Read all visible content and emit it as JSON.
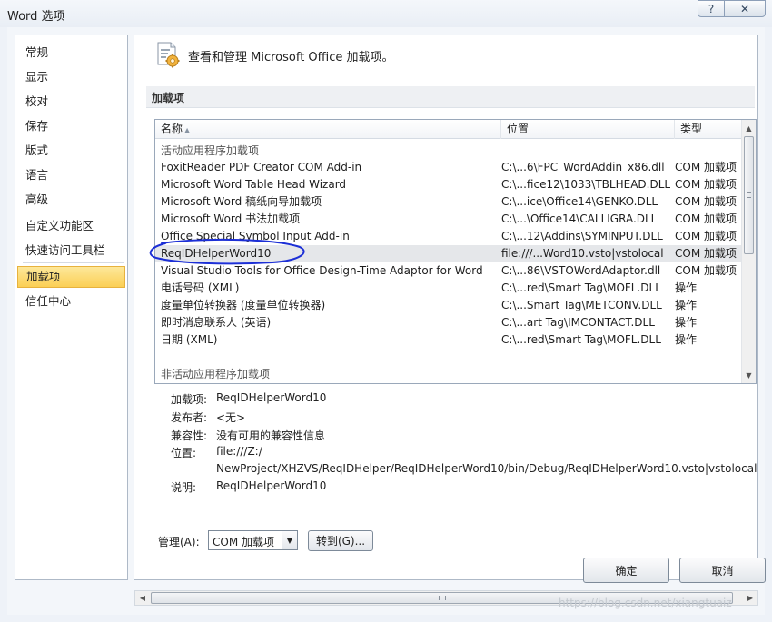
{
  "window": {
    "title": "Word 选项",
    "help_label": "?",
    "close_label": "✕"
  },
  "sidebar": {
    "items": [
      {
        "label": "常规"
      },
      {
        "label": "显示"
      },
      {
        "label": "校对"
      },
      {
        "label": "保存"
      },
      {
        "label": "版式"
      },
      {
        "label": "语言"
      },
      {
        "label": "高级"
      },
      {
        "label": "自定义功能区"
      },
      {
        "label": "快速访问工具栏"
      },
      {
        "label": "加载项"
      },
      {
        "label": "信任中心"
      }
    ],
    "selected": "加载项"
  },
  "header": {
    "text": "查看和管理 Microsoft Office 加载项。",
    "icon": "addin-gear-icon"
  },
  "section": {
    "title": "加载项"
  },
  "list": {
    "columns": {
      "name": "名称",
      "location": "位置",
      "type": "类型"
    },
    "sort_indicator": "▲",
    "groups": {
      "active": "活动应用程序加载项",
      "inactive": "非活动应用程序加载项"
    },
    "rows": [
      {
        "name": "FoxitReader PDF Creator COM Add-in",
        "location": "C:\\...6\\FPC_WordAddin_x86.dll",
        "type": "COM 加载项"
      },
      {
        "name": "Microsoft Word Table Head Wizard",
        "location": "C:\\...fice12\\1033\\TBLHEAD.DLL",
        "type": "COM 加载项"
      },
      {
        "name": "Microsoft Word 稿纸向导加载项",
        "location": "C:\\...ice\\Office14\\GENKO.DLL",
        "type": "COM 加载项"
      },
      {
        "name": "Microsoft Word 书法加载项",
        "location": "C:\\...\\Office14\\CALLIGRA.DLL",
        "type": "COM 加载项"
      },
      {
        "name": "Office Special Symbol Input Add-in",
        "location": "C:\\...12\\Addins\\SYMINPUT.DLL",
        "type": "COM 加载项"
      },
      {
        "name": "ReqIDHelperWord10",
        "location": "file:///...Word10.vsto|vstolocal",
        "type": "COM 加载项"
      },
      {
        "name": "Visual Studio Tools for Office Design-Time Adaptor for Word",
        "location": "C:\\...86\\VSTOWordAdaptor.dll",
        "type": "COM 加载项"
      },
      {
        "name": "电话号码 (XML)",
        "location": "C:\\...red\\Smart Tag\\MOFL.DLL",
        "type": "操作"
      },
      {
        "name": "度量单位转换器 (度量单位转换器)",
        "location": "C:\\...Smart Tag\\METCONV.DLL",
        "type": "操作"
      },
      {
        "name": "即时消息联系人 (英语)",
        "location": "C:\\...art Tag\\IMCONTACT.DLL",
        "type": "操作"
      },
      {
        "name": "日期 (XML)",
        "location": "C:\\...red\\Smart Tag\\MOFL.DLL",
        "type": "操作"
      }
    ],
    "selected_row": "ReqIDHelperWord10"
  },
  "details": {
    "addin_label": "加载项:",
    "addin_value": "ReqIDHelperWord10",
    "publisher_label": "发布者:",
    "publisher_value": "<无>",
    "compat_label": "兼容性:",
    "compat_value": "没有可用的兼容性信息",
    "location_label": "位置:",
    "location_value_1": "file:///Z:/",
    "location_value_2": "NewProject/XHZVS/ReqIDHelper/ReqIDHelperWord10/bin/Debug/ReqIDHelperWord10.vsto|vstolocal",
    "desc_label": "说明:",
    "desc_value": "ReqIDHelperWord10"
  },
  "manage": {
    "label": "管理(A):",
    "selected_value": "COM 加载项",
    "goto_label": "转到(G)..."
  },
  "buttons": {
    "ok": "确定",
    "cancel": "取消"
  },
  "watermark": "https://blog.csdn.net/xiangtuaiz",
  "colors": {
    "selected_nav": "#fbcf55",
    "annotation": "#1c2fd6",
    "selected_row": "#e5e7ea"
  }
}
